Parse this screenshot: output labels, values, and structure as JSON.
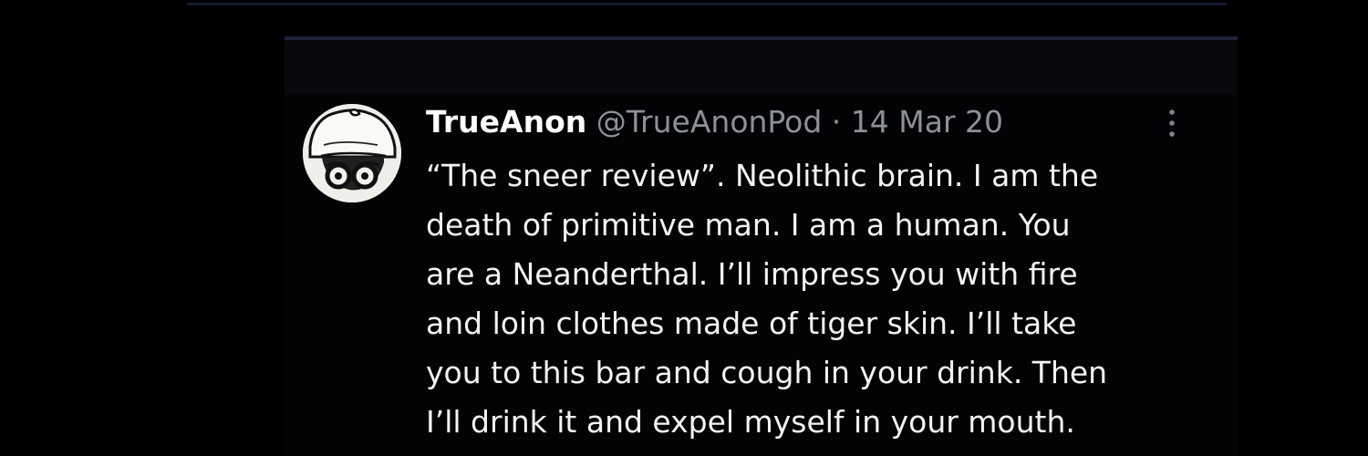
{
  "tweet": {
    "display_name": "TrueAnon",
    "handle": "@TrueAnonPod",
    "separator": "·",
    "timestamp": "14 Mar 20",
    "body_lines": [
      "“The sneer review”. Neolithic brain. I am the",
      "death of primitive man. I am a human. You",
      "are a Neanderthal. I’ll impress you with fire",
      "and loin clothes made of tiger skin. I’ll take",
      "you to this bar and cough in your drink. Then",
      "I’ll drink it and expel myself in your mouth."
    ]
  },
  "icons": {
    "avatar": "hat-glasses-avatar",
    "more": "more-vertical-icon"
  },
  "colors": {
    "background": "#000000",
    "card": "#030305",
    "divider": "#1b2238",
    "name": "#ffffff",
    "meta": "#8b9198",
    "text": "#f3f3f3"
  }
}
